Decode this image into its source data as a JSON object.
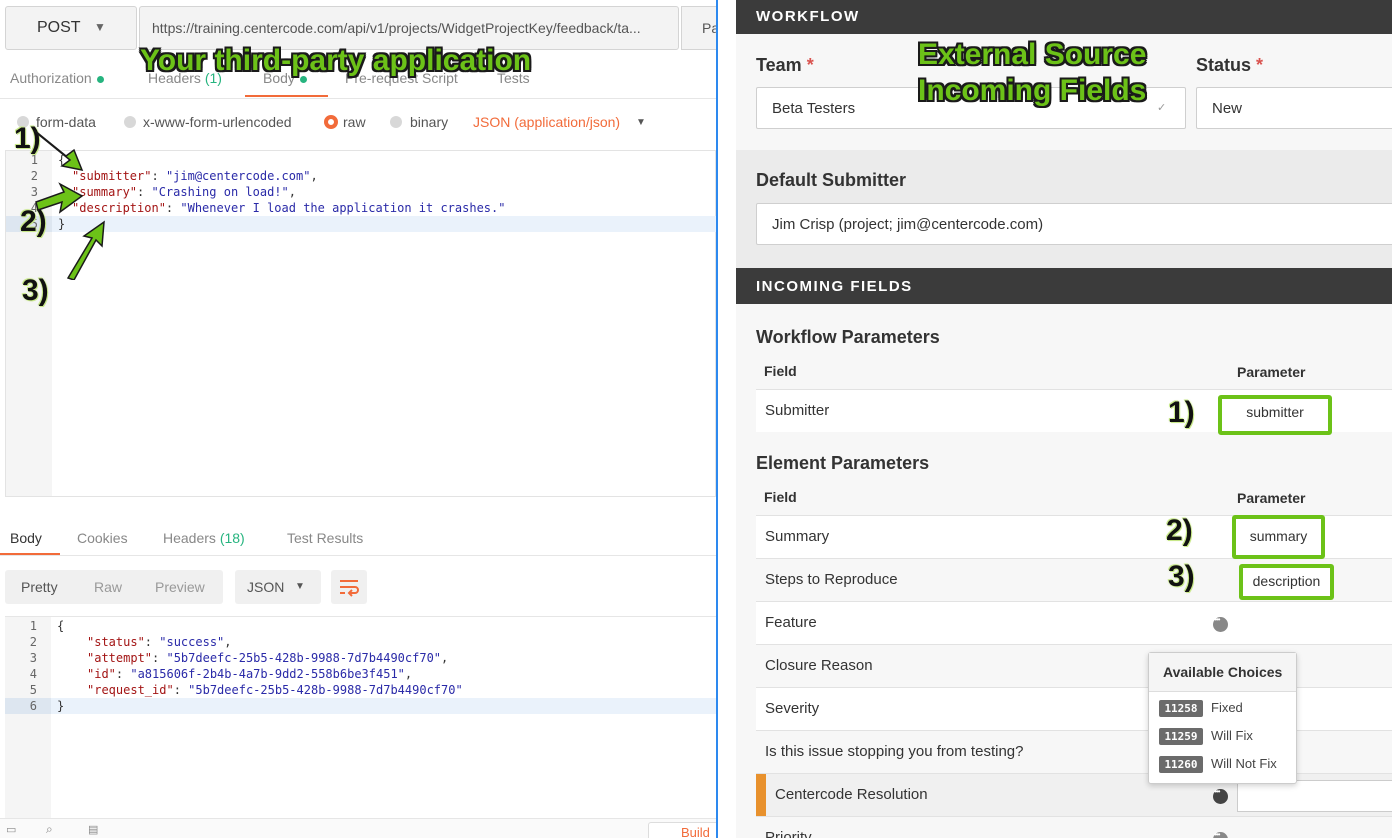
{
  "request": {
    "method": "POST",
    "url": "https://training.centercode.com/api/v1/projects/WidgetProjectKey/feedback/ta...",
    "params_label": "Pa",
    "tabs": [
      "Authorization",
      "Headers",
      "(1)",
      "Body",
      "Pre-request Script",
      "Tests"
    ],
    "body_options": [
      "form-data",
      "x-www-form-urlencoded",
      "raw",
      "binary"
    ],
    "content_type": "JSON (application/json)",
    "body_lines": [
      {
        "n": "1",
        "text": "{"
      },
      {
        "n": "2",
        "key": "\"submitter\"",
        "val": "\"jim@centercode.com\""
      },
      {
        "n": "3",
        "key": "\"summary\"",
        "val": "\"Crashing on load!\""
      },
      {
        "n": "4",
        "key": "\"description\"",
        "val": "\"Whenever I load the application it crashes.\""
      },
      {
        "n": "5",
        "text": "}"
      }
    ]
  },
  "response": {
    "tabs": [
      "Body",
      "Cookies",
      "Headers",
      "(18)",
      "Test Results"
    ],
    "format_buttons": [
      "Pretty",
      "Raw",
      "Preview"
    ],
    "format_select": "JSON",
    "lines": [
      {
        "n": "1",
        "text": "{"
      },
      {
        "n": "2",
        "key": "\"status\"",
        "val": "\"success\""
      },
      {
        "n": "3",
        "key": "\"attempt\"",
        "val": "\"5b7deefc-25b5-428b-9988-7d7b4490cf70\""
      },
      {
        "n": "4",
        "key": "\"id\"",
        "val": "\"a815606f-2b4b-4a7b-9dd2-558b6be3f451\""
      },
      {
        "n": "5",
        "key": "\"request_id\"",
        "val": "\"5b7deefc-25b5-428b-9988-7d7b4490cf70\""
      },
      {
        "n": "6",
        "text": "}"
      }
    ],
    "build_label": "Build"
  },
  "annotations": {
    "left_title": "Your third-party application",
    "right_title_1": "External Source",
    "right_title_2": "Incoming Fields",
    "n1": "1)",
    "n2": "2)",
    "n3": "3)"
  },
  "workflow": {
    "header": "WORKFLOW",
    "team_label": "Team",
    "team_value": "Beta Testers",
    "status_label": "Status",
    "status_value": "New",
    "required_mark": "*",
    "default_submitter_label": "Default Submitter",
    "default_submitter_value": "Jim Crisp (project; jim@centercode.com)"
  },
  "incoming": {
    "header": "INCOMING FIELDS",
    "workflow_params_title": "Workflow Parameters",
    "element_params_title": "Element Parameters",
    "col_field": "Field",
    "col_parameter": "Parameter",
    "workflow_rows": [
      {
        "field": "Submitter",
        "param": "submitter"
      }
    ],
    "element_rows": [
      {
        "field": "Summary",
        "param": "summary"
      },
      {
        "field": "Steps to Reproduce",
        "param": "description"
      },
      {
        "field": "Feature",
        "param": ""
      },
      {
        "field": "Closure Reason",
        "param": ""
      },
      {
        "field": "Severity",
        "param": ""
      },
      {
        "field": "Is this issue stopping you from testing?",
        "param": ""
      },
      {
        "field": "Centercode Resolution",
        "param": ""
      },
      {
        "field": "Priority",
        "param": ""
      }
    ]
  },
  "popover": {
    "title": "Available Choices",
    "choices": [
      {
        "id": "11258",
        "label": "Fixed"
      },
      {
        "id": "11259",
        "label": "Will Fix"
      },
      {
        "id": "11260",
        "label": "Will Not Fix"
      }
    ]
  },
  "colors": {
    "accent": "#f26b3a",
    "annotation": "#6cc218",
    "dark_bar": "#3b3b3b",
    "resolution_marker": "#e8912d"
  }
}
